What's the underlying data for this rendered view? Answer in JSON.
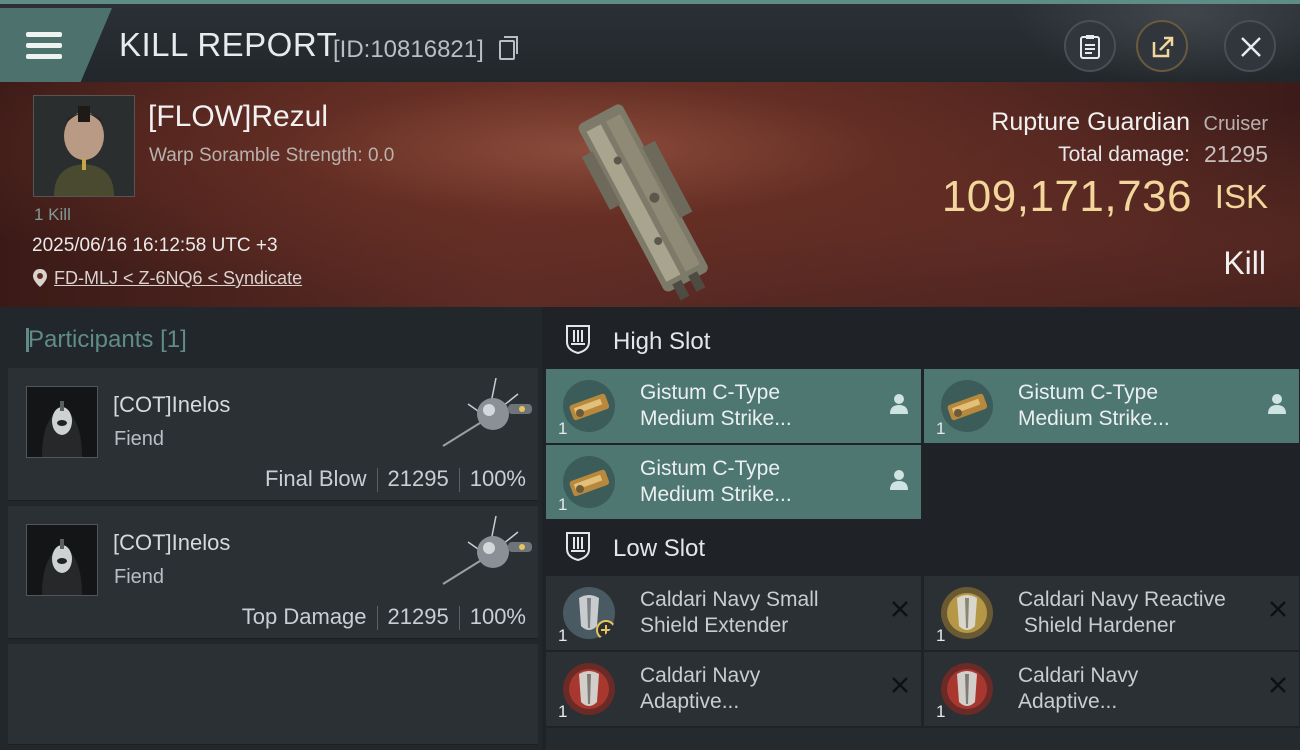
{
  "header": {
    "title": "KILL REPORT",
    "report_id": "[ID:10816821]",
    "actions": [
      "clipboard-icon",
      "share-icon",
      "close-icon"
    ]
  },
  "victim": {
    "name": "[FLOW]Rezul",
    "warp_scramble": "Warp Soramble Strength: 0.0",
    "kills": "1 Kill",
    "datetime": "2025/06/16 16:12:58 UTC +3",
    "location": "FD-MLJ < Z-6NQ6 < Syndicate",
    "ship_name": "Rupture Guardian",
    "ship_class": "Cruiser",
    "total_damage_label": "Total damage:",
    "total_damage": "21295",
    "isk_value": "109,171,736",
    "isk_unit": "ISK",
    "result": "Kill"
  },
  "participants": {
    "title": "Participants",
    "count": "[1]",
    "items": [
      {
        "name": "[COT]Inelos",
        "ship": "Fiend",
        "role": "Final Blow",
        "damage": "21295",
        "percent": "100%"
      },
      {
        "name": "[COT]Inelos",
        "ship": "Fiend",
        "role": "Top Damage",
        "damage": "21295",
        "percent": "100%"
      }
    ]
  },
  "slots": {
    "high": {
      "label": "High Slot",
      "modules": [
        {
          "line1": "Gistum C-Type",
          "line2": "Medium Strike...",
          "qty": "1",
          "status": "fitted"
        },
        {
          "line1": "Gistum C-Type",
          "line2": "Medium Strike...",
          "qty": "1",
          "status": "fitted"
        },
        {
          "line1": "Gistum C-Type",
          "line2": "Medium Strike...",
          "qty": "1",
          "status": "fitted"
        }
      ]
    },
    "low": {
      "label": "Low Slot",
      "modules": [
        {
          "line1": "Caldari Navy Small",
          "line2": "Shield Extender",
          "qty": "1",
          "status": "destroyed"
        },
        {
          "line1": "Caldari Navy Reactive",
          "line2": " Shield Hardener",
          "qty": "1",
          "status": "destroyed"
        },
        {
          "line1": "Caldari Navy",
          "line2": "Adaptive...",
          "qty": "1",
          "status": "destroyed"
        },
        {
          "line1": "Caldari Navy",
          "line2": "Adaptive...",
          "qty": "1",
          "status": "destroyed"
        }
      ]
    }
  },
  "colors": {
    "accent": "#5f8c87",
    "fitted_bg": "#4f7772",
    "isk": "#f2d69b"
  }
}
